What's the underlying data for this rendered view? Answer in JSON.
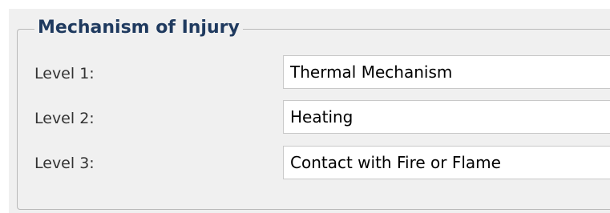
{
  "group": {
    "title": "Mechanism of Injury"
  },
  "rows": [
    {
      "label": "Level 1:",
      "value": "Thermal Mechanism"
    },
    {
      "label": "Level 2:",
      "value": "Heating"
    },
    {
      "label": "Level 3:",
      "value": "Contact with Fire or Flame"
    }
  ],
  "colors": {
    "panel_background": "#f0f0f0",
    "title_text": "#1f3a5f",
    "label_text": "#333333",
    "field_border": "#c8c8c8"
  }
}
